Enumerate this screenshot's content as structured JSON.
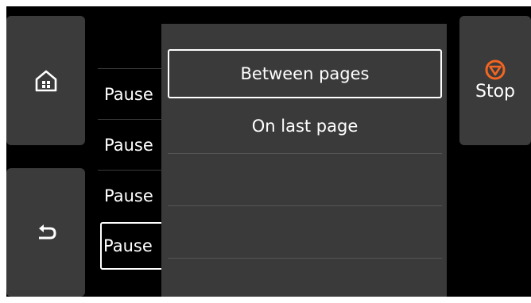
{
  "nav": {
    "home_icon": "home-icon",
    "back_icon": "back-arrow-icon",
    "stop_icon": "stop-icon",
    "stop_label": "Stop"
  },
  "background_list": {
    "items": [
      {
        "label": "Pause"
      },
      {
        "label": "Pause"
      },
      {
        "label": "Pause"
      },
      {
        "label": "Pause"
      }
    ],
    "selected_index": 3
  },
  "popup": {
    "options": [
      {
        "label": "Between pages"
      },
      {
        "label": "On last page"
      }
    ],
    "selected_index": 0
  },
  "colors": {
    "background": "#000000",
    "button": "#3b3b3b",
    "popup": "#3a3a3a",
    "text": "#ffffff",
    "stop_accent": "#f26522"
  }
}
